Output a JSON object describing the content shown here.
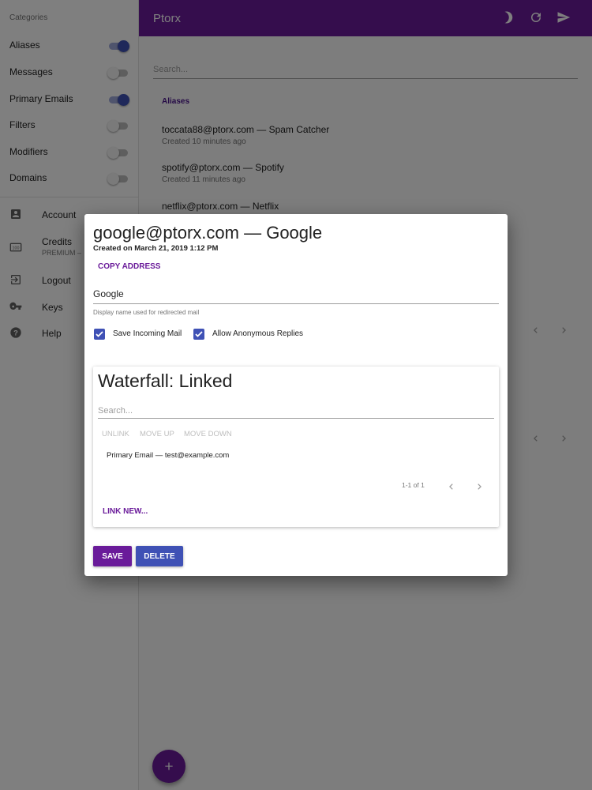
{
  "sidebar": {
    "categories_header": "Categories",
    "categories": [
      {
        "label": "Aliases",
        "enabled": true
      },
      {
        "label": "Messages",
        "enabled": false
      },
      {
        "label": "Primary Emails",
        "enabled": true
      },
      {
        "label": "Filters",
        "enabled": false
      },
      {
        "label": "Modifiers",
        "enabled": false
      },
      {
        "label": "Domains",
        "enabled": false
      }
    ],
    "nav": [
      {
        "label": "Account",
        "icon": "account-box-icon"
      },
      {
        "label": "Credits",
        "sublabel": "PREMIUM –",
        "icon": "credits-icon"
      },
      {
        "label": "Logout",
        "icon": "logout-icon"
      },
      {
        "label": "Keys",
        "icon": "key-icon"
      },
      {
        "label": "Help",
        "icon": "help-icon"
      }
    ]
  },
  "appbar": {
    "title": "Ptorx",
    "icons": [
      "moon-icon",
      "refresh-icon",
      "send-icon"
    ]
  },
  "main": {
    "search_placeholder": "Search...",
    "aliases_header": "Aliases",
    "aliases": [
      {
        "primary": "toccata88@ptorx.com — Spam Catcher",
        "secondary": "Created 10 minutes ago"
      },
      {
        "primary": "spotify@ptorx.com — Spotify",
        "secondary": "Created 11 minutes ago"
      },
      {
        "primary": "netflix@ptorx.com — Netflix",
        "secondary": ""
      }
    ]
  },
  "dialog": {
    "title": "google@ptorx.com — Google",
    "created": "Created on March 21, 2019 1:12 PM",
    "copy_label": "COPY ADDRESS",
    "name_value": "Google",
    "name_helper": "Display name used for redirected mail",
    "checkboxes": [
      {
        "label": "Save Incoming Mail",
        "checked": true
      },
      {
        "label": "Allow Anonymous Replies",
        "checked": true
      }
    ],
    "waterfall": {
      "title": "Waterfall: Linked",
      "search_placeholder": "Search...",
      "actions": [
        "UNLINK",
        "MOVE UP",
        "MOVE DOWN"
      ],
      "rows": [
        "Primary Email — test@example.com"
      ],
      "pagination": "1-1 of 1",
      "link_new": "LINK NEW..."
    },
    "save_label": "SAVE",
    "delete_label": "DELETE"
  },
  "colors": {
    "primary": "#6a1b9a",
    "accent": "#3f51b5"
  }
}
